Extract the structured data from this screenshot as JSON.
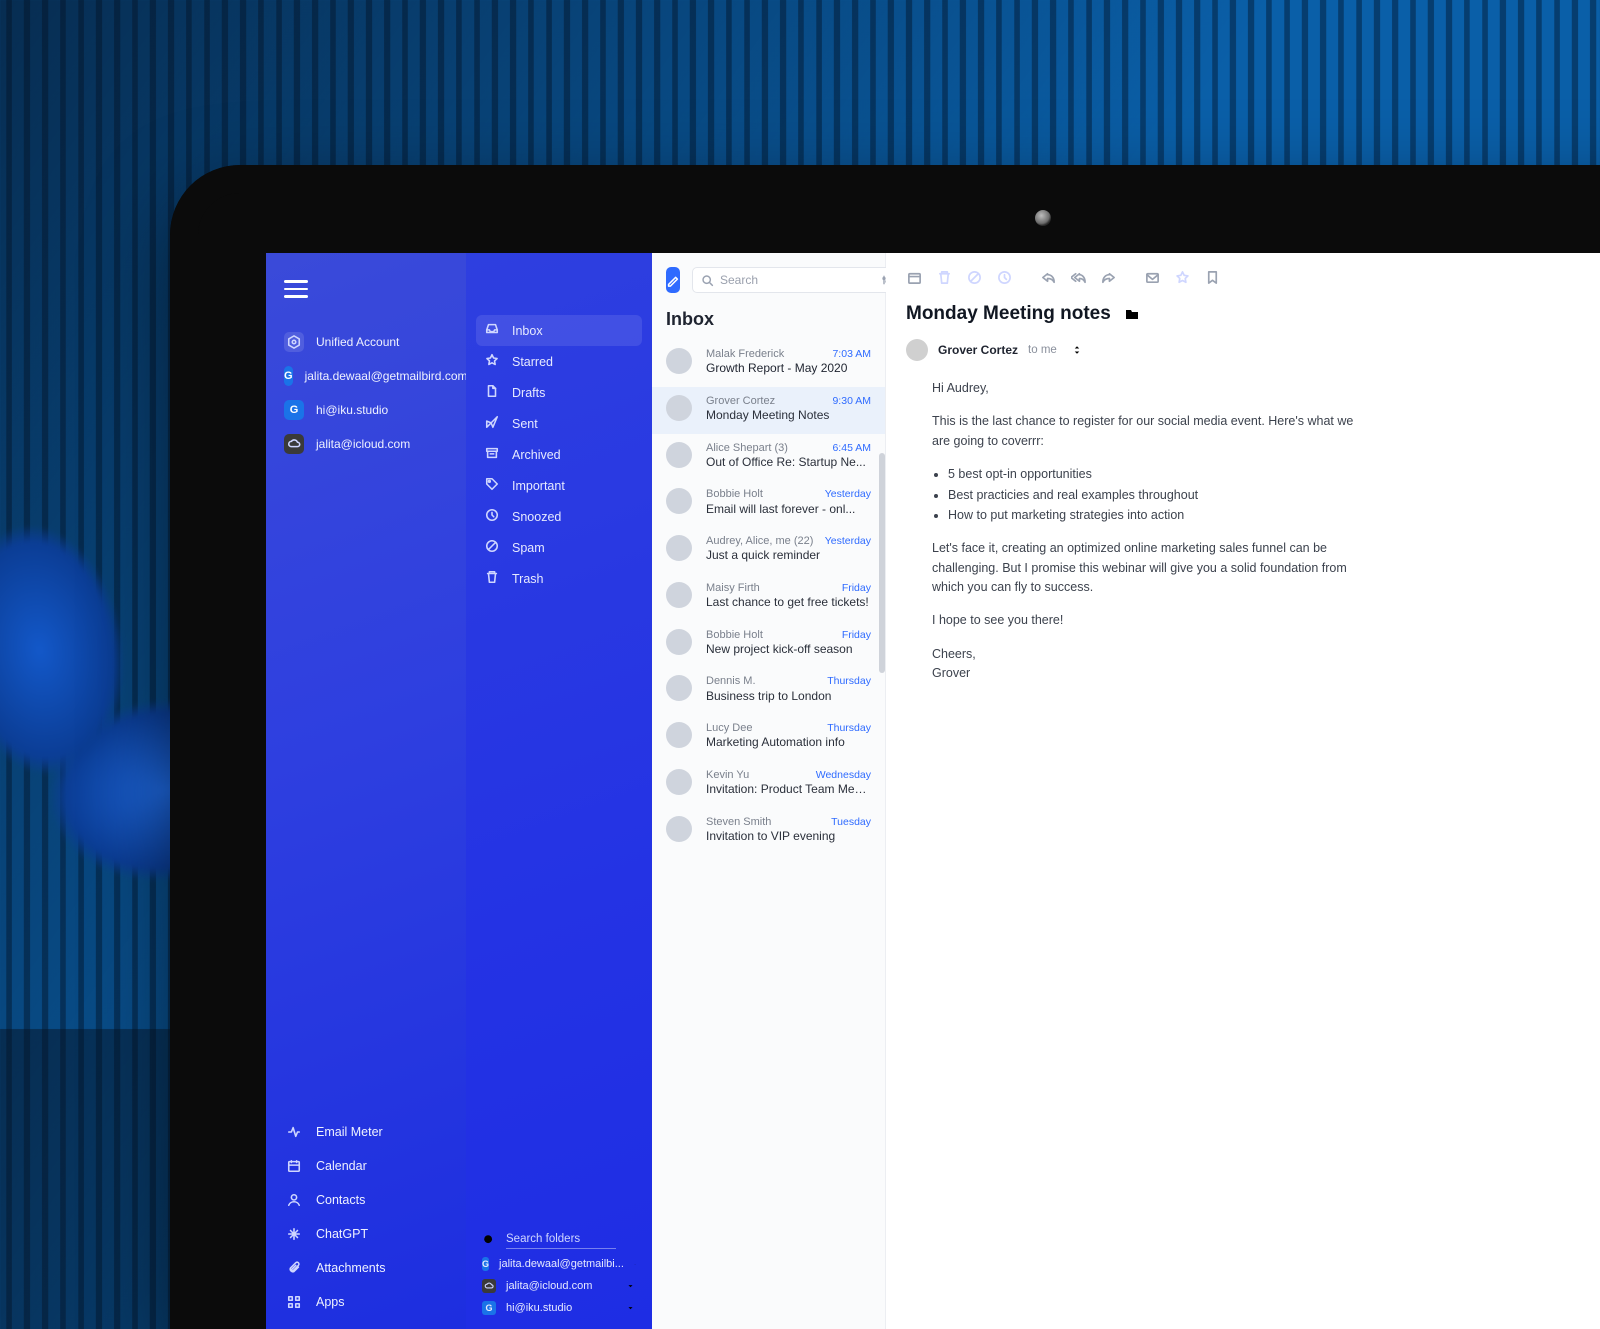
{
  "rail": {
    "unified_label": "Unified Account",
    "accounts": [
      {
        "label": "jalita.dewaal@getmailbird.com",
        "kind": "g"
      },
      {
        "label": "hi@iku.studio",
        "kind": "g"
      },
      {
        "label": "jalita@icloud.com",
        "kind": "ic"
      }
    ],
    "tools": [
      {
        "label": "Email Meter",
        "icon": "activity"
      },
      {
        "label": "Calendar",
        "icon": "calendar"
      },
      {
        "label": "Contacts",
        "icon": "user"
      },
      {
        "label": "ChatGPT",
        "icon": "sparkle"
      },
      {
        "label": "Attachments",
        "icon": "paperclip"
      },
      {
        "label": "Apps",
        "icon": "grid"
      }
    ]
  },
  "folders": {
    "items": [
      {
        "label": "Inbox",
        "icon": "inbox",
        "active": true
      },
      {
        "label": "Starred",
        "icon": "star"
      },
      {
        "label": "Drafts",
        "icon": "file"
      },
      {
        "label": "Sent",
        "icon": "send"
      },
      {
        "label": "Archived",
        "icon": "archive"
      },
      {
        "label": "Important",
        "icon": "tag"
      },
      {
        "label": "Snoozed",
        "icon": "clock"
      },
      {
        "label": "Spam",
        "icon": "slash"
      },
      {
        "label": "Trash",
        "icon": "trash"
      }
    ],
    "search_placeholder": "Search folders",
    "mailboxes": [
      {
        "label": "jalita.dewaal@getmailbi...",
        "kind": "g"
      },
      {
        "label": "jalita@icloud.com",
        "kind": "ic"
      },
      {
        "label": "hi@iku.studio",
        "kind": "g"
      }
    ]
  },
  "list": {
    "search_placeholder": "Search",
    "heading": "Inbox",
    "messages": [
      {
        "from": "Malak Frederick",
        "time": "7:03 AM",
        "subject": "Growth Report - May 2020"
      },
      {
        "from": "Grover Cortez",
        "time": "9:30 AM",
        "subject": "Monday Meeting Notes",
        "selected": true
      },
      {
        "from": "Alice Shepart (3)",
        "time": "6:45 AM",
        "subject": "Out of Office Re: Startup Ne..."
      },
      {
        "from": "Bobbie Holt",
        "time": "Yesterday",
        "subject": "Email will last forever - onl..."
      },
      {
        "from": "Audrey, Alice, me (22)",
        "time": "Yesterday",
        "subject": "Just a quick reminder"
      },
      {
        "from": "Maisy Firth",
        "time": "Friday",
        "subject": "Last chance to get free tickets!"
      },
      {
        "from": "Bobbie Holt",
        "time": "Friday",
        "subject": "New project kick-off season"
      },
      {
        "from": "Dennis M.",
        "time": "Thursday",
        "subject": "Business trip to London"
      },
      {
        "from": "Lucy Dee",
        "time": "Thursday",
        "subject": "Marketing Automation info"
      },
      {
        "from": "Kevin Yu",
        "time": "Wednesday",
        "subject": "Invitation: Product Team Meeting"
      },
      {
        "from": "Steven Smith",
        "time": "Tuesday",
        "subject": "Invitation to VIP evening"
      }
    ]
  },
  "reader": {
    "title": "Monday Meeting notes",
    "sender": "Grover Cortez",
    "recipient": "to me",
    "greeting": "Hi Audrey,",
    "intro": "This is the last chance to register for our social media event. Here's what we are going to coverrr:",
    "bullets": [
      "5 best opt-in opportunities",
      "Best practicies and real examples throughout",
      "How to put marketing strategies into action"
    ],
    "para2": "Let's face it, creating an optimized online marketing sales funnel can be challenging. But I promise this webinar will give you a solid foundation from which you can fly to success.",
    "para3": "I hope to see you there!",
    "signoff1": "Cheers,",
    "signoff2": "Grover"
  }
}
